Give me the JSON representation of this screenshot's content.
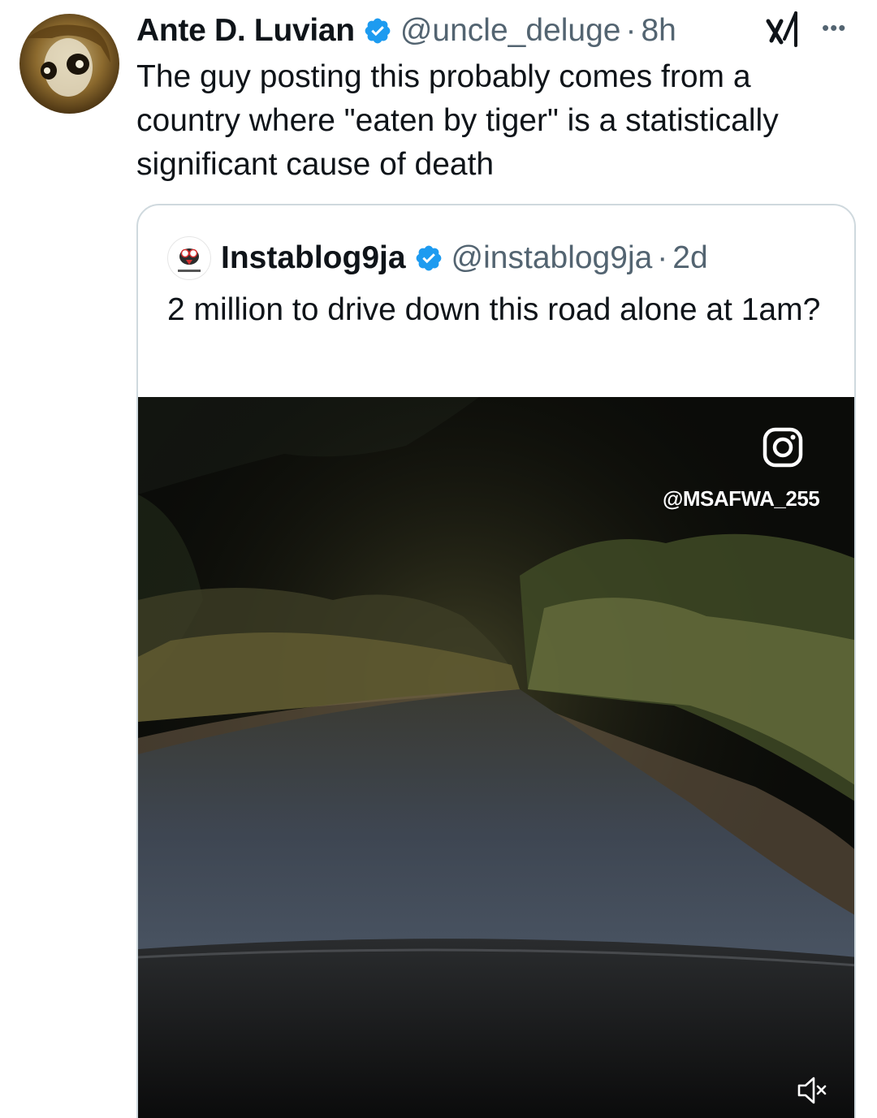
{
  "tweet": {
    "author_name": "Ante D. Luvian",
    "author_handle": "@uncle_deluge",
    "separator": "·",
    "time": "8h",
    "text": "The guy posting this probably comes from a country where \"eaten by tiger\" is a statistically significant cause of death",
    "verified": true,
    "icons": [
      "verified-badge-icon",
      "grok-icon",
      "more-options-icon"
    ]
  },
  "quoted_tweet": {
    "author_name": "Instablog9ja",
    "author_handle": "@instablog9ja",
    "separator": "·",
    "time": "2d",
    "text": "2 million to drive down this road alone at 1am?",
    "verified": true,
    "media": {
      "type": "video",
      "watermark": "@MSAFWA_255",
      "icons": [
        "instagram-icon",
        "mute-icon"
      ]
    }
  },
  "colors": {
    "text_primary": "#0f1419",
    "text_secondary": "#536471",
    "verified_blue": "#1d9bf0",
    "border": "#cfd9de"
  }
}
